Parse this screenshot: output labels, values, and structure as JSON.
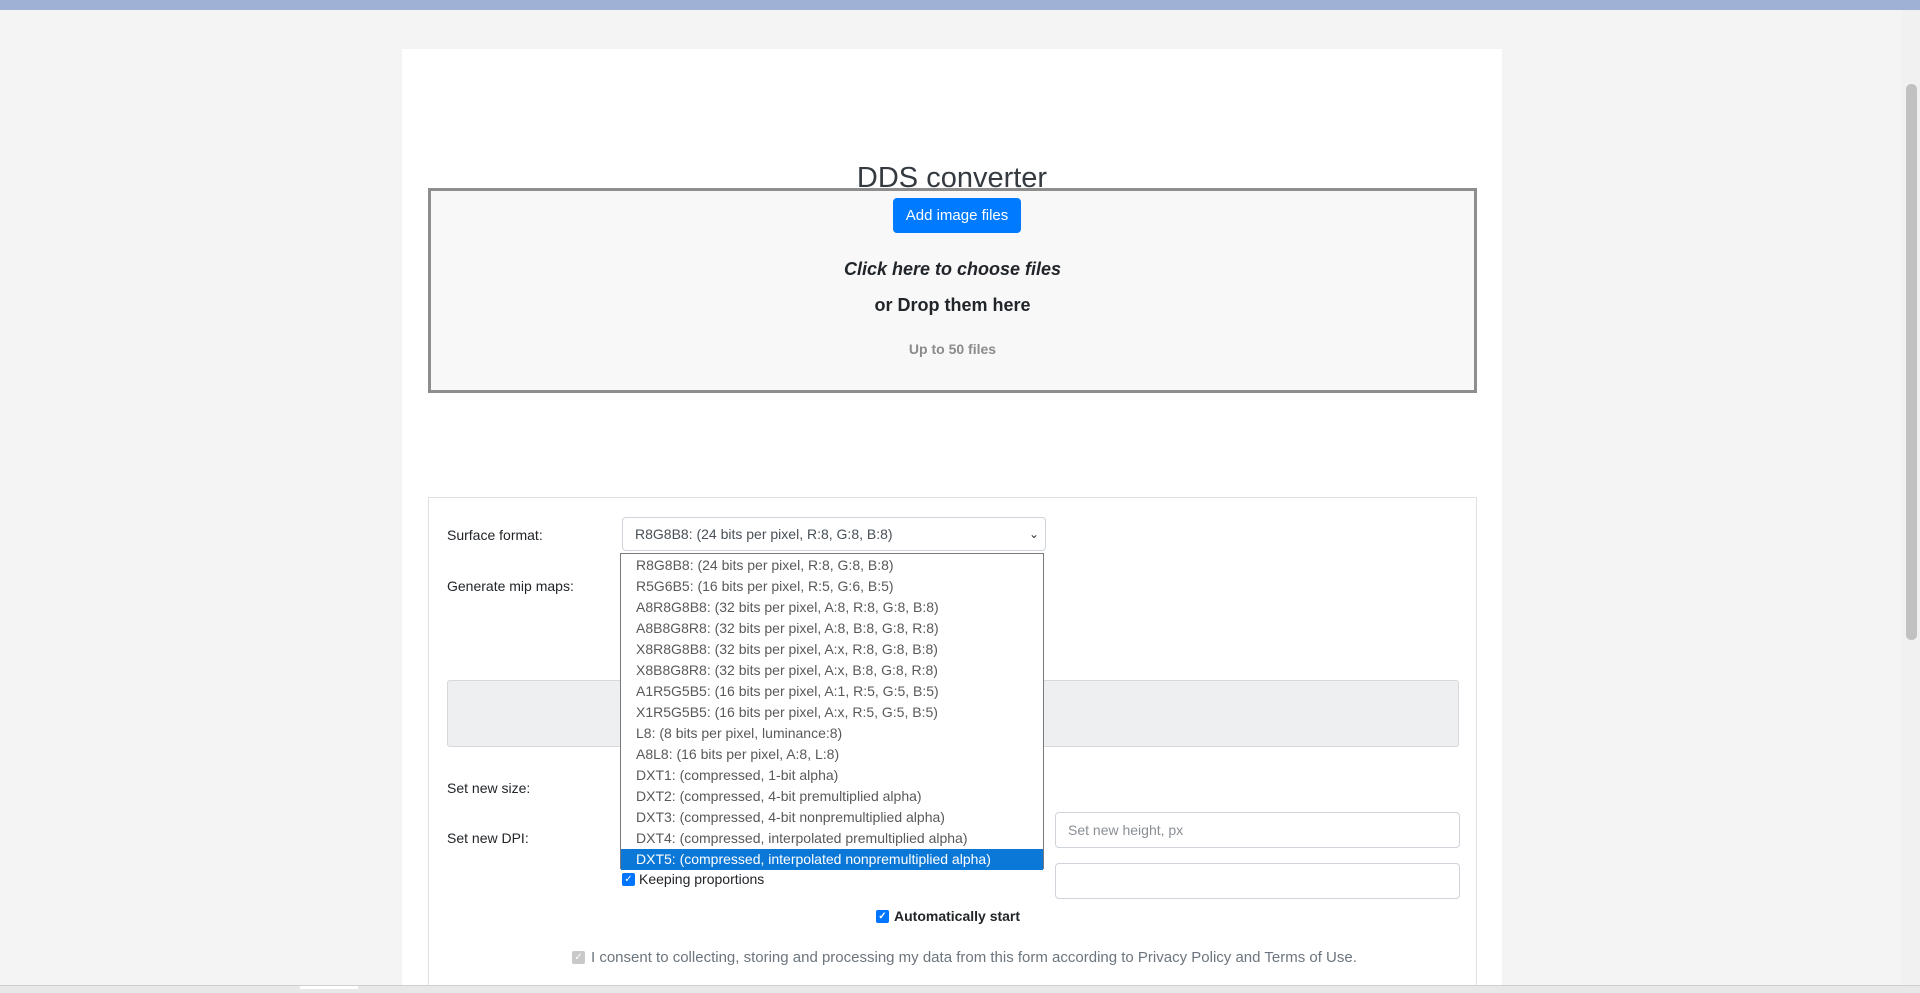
{
  "page": {
    "title": "DDS converter"
  },
  "upload": {
    "add_button": "Add image files",
    "choose_text": "Click here to choose files",
    "drop_text": "or Drop them here",
    "limit_text": "Up to 50 files"
  },
  "options": {
    "surface_format_label": "Surface format:",
    "surface_format_value": "R8G8B8: (24 bits per pixel, R:8, G:8, B:8)",
    "mip_maps_label": "Generate mip maps:",
    "new_size_label": "Set new size:",
    "new_height_placeholder": "Set new height, px",
    "new_dpi_label": "Set new DPI:",
    "keep_proportions": "Keeping proportions",
    "auto_start": "Automatically start",
    "consent": "I consent to collecting, storing and processing my data from this form according to Privacy Policy and Terms of Use."
  },
  "dropdown": {
    "items": [
      "R8G8B8: (24 bits per pixel, R:8, G:8, B:8)",
      "R5G6B5: (16 bits per pixel, R:5, G:6, B:5)",
      "A8R8G8B8: (32 bits per pixel, A:8, R:8, G:8, B:8)",
      "A8B8G8R8: (32 bits per pixel, A:8, B:8, G:8, R:8)",
      "X8R8G8B8: (32 bits per pixel, A:x, R:8, G:8, B:8)",
      "X8B8G8R8: (32 bits per pixel, A:x, B:8, G:8, R:8)",
      "A1R5G5B5: (16 bits per pixel, A:1, R:5, G:5, B:5)",
      "X1R5G5B5: (16 bits per pixel, A:x, R:5, G:5, B:5)",
      "L8: (8 bits per pixel, luminance:8)",
      "A8L8: (16 bits per pixel, A:8, L:8)",
      "DXT1: (compressed, 1-bit alpha)",
      "DXT2: (compressed, 4-bit premultiplied alpha)",
      "DXT3: (compressed, 4-bit nonpremultiplied alpha)",
      "DXT4: (compressed, interpolated premultiplied alpha)",
      "DXT5: (compressed, interpolated nonpremultiplied alpha)"
    ],
    "highlighted": "DXT5: (compressed, interpolated nonpremultiplied alpha)"
  },
  "colors": {
    "primary_button": "#007bff",
    "highlight": "#0b78d7"
  }
}
